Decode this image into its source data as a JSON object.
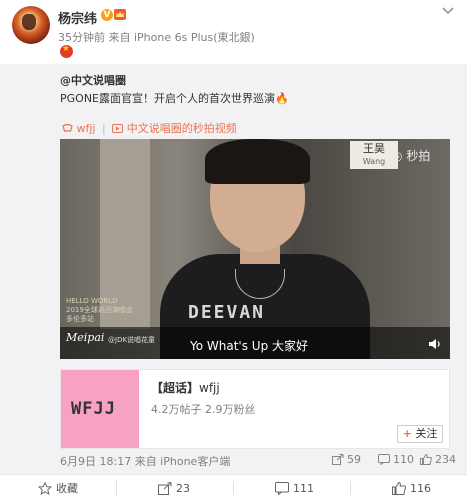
{
  "post": {
    "author": "杨宗纬",
    "v_badge": "V",
    "meta": "35分钟前 来自 iPhone 6s Plus(東北銀)"
  },
  "repost": {
    "author": "@中文说唱圈",
    "text": "PGONE露面官宣！开启个人的首次世界巡演",
    "video_source_tag": "wfjj",
    "video_link": "中文说唱圈的秒拍视频"
  },
  "video": {
    "name_tag_cn": "王昊",
    "name_tag_en": "Wang",
    "watermark": "秒拍",
    "overlay_line1": "HELLO WORLD",
    "overlay_line2": "2019全球巡回演唱会",
    "overlay_line3": "多伦多站",
    "brand": "Meipai",
    "brand_id": "@JDK说唱花童",
    "shirt_text": "DEEVAN",
    "subtitle": "Yo What's Up 大家好"
  },
  "card": {
    "thumb_text": "WFJJ",
    "title_prefix": "【超话】",
    "title": "wfjj",
    "stats": "4.2万帖子 2.9万粉丝",
    "follow_label": "关注"
  },
  "info": {
    "time": "6月9日 18:17 来自 iPhone客户端",
    "share_count": "59",
    "comment_count": "110",
    "like_count": "234"
  },
  "actions": {
    "favorite_label": "收藏",
    "share_count": "23",
    "comment_count": "111",
    "like_count": "116"
  },
  "colors": {
    "accent": "#eb7350",
    "vip": "#f8a118",
    "background_repost": "#f2f2f5"
  }
}
